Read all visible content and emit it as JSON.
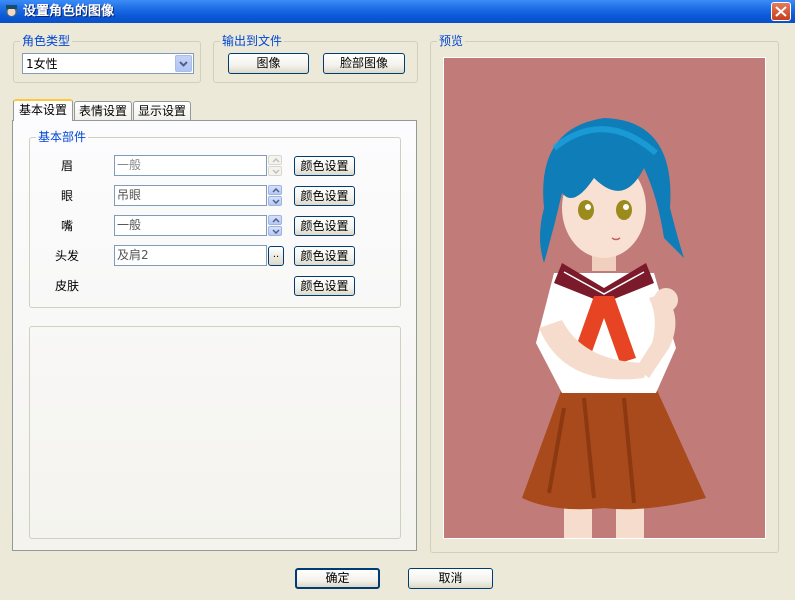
{
  "window": {
    "title": "设置角色的图像"
  },
  "character_type": {
    "legend": "角色类型",
    "selected": "1女性"
  },
  "output": {
    "legend": "输出到文件",
    "image_button": "图像",
    "face_button": "脸部图像"
  },
  "tabs": [
    {
      "label": "基本设置",
      "active": true
    },
    {
      "label": "表情设置",
      "active": false
    },
    {
      "label": "显示设置",
      "active": false
    }
  ],
  "basic_parts": {
    "legend": "基本部件",
    "color_button": "颜色设置",
    "rows": [
      {
        "label": "眉",
        "value": "一般",
        "enabled": false
      },
      {
        "label": "眼",
        "value": "吊眼",
        "enabled": true
      },
      {
        "label": "嘴",
        "value": "一般",
        "enabled": true
      },
      {
        "label": "头发",
        "value": "及肩2",
        "enabled": true
      },
      {
        "label": "皮肤"
      }
    ]
  },
  "preview": {
    "legend": "预览",
    "background": "#c17c7a"
  },
  "footer": {
    "ok": "确定",
    "cancel": "取消"
  }
}
